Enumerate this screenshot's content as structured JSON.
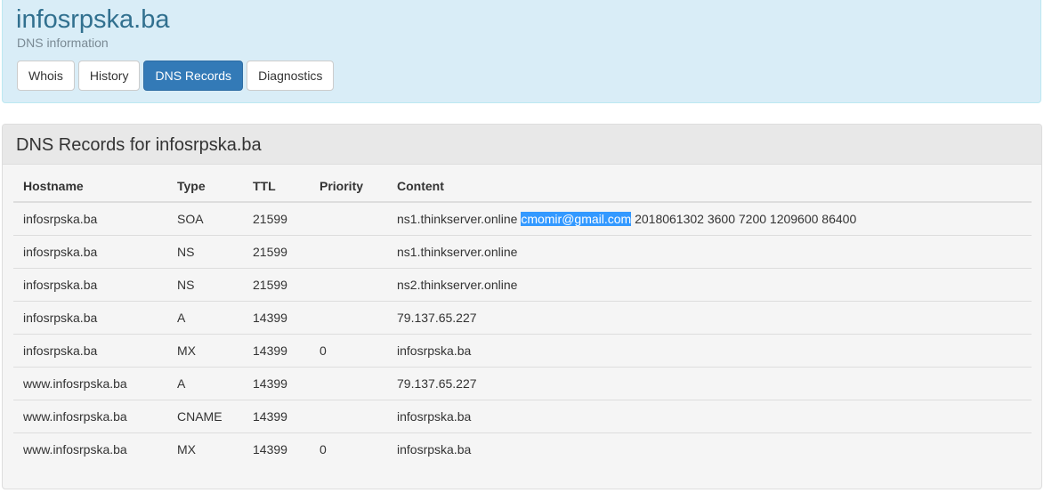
{
  "site": {
    "title": "infosrpska.ba",
    "subtitle": "DNS information"
  },
  "tabs": [
    {
      "label": "Whois",
      "active": false
    },
    {
      "label": "History",
      "active": false
    },
    {
      "label": "DNS Records",
      "active": true
    },
    {
      "label": "Diagnostics",
      "active": false
    }
  ],
  "panel": {
    "heading": "DNS Records for infosrpska.ba"
  },
  "table": {
    "columns": [
      "Hostname",
      "Type",
      "TTL",
      "Priority",
      "Content"
    ],
    "rows": [
      {
        "hostname": "infosrpska.ba",
        "type": "SOA",
        "ttl": "21599",
        "priority": "",
        "content_pre": "ns1.thinkserver.online ",
        "content_highlight": "cmomir@gmail.com",
        "content_post": " 2018061302 3600 7200 1209600 86400"
      },
      {
        "hostname": "infosrpska.ba",
        "type": "NS",
        "ttl": "21599",
        "priority": "",
        "content_pre": "ns1.thinkserver.online",
        "content_highlight": "",
        "content_post": ""
      },
      {
        "hostname": "infosrpska.ba",
        "type": "NS",
        "ttl": "21599",
        "priority": "",
        "content_pre": "ns2.thinkserver.online",
        "content_highlight": "",
        "content_post": ""
      },
      {
        "hostname": "infosrpska.ba",
        "type": "A",
        "ttl": "14399",
        "priority": "",
        "content_pre": "79.137.65.227",
        "content_highlight": "",
        "content_post": ""
      },
      {
        "hostname": "infosrpska.ba",
        "type": "MX",
        "ttl": "14399",
        "priority": "0",
        "content_pre": "infosrpska.ba",
        "content_highlight": "",
        "content_post": ""
      },
      {
        "hostname": "www.infosrpska.ba",
        "type": "A",
        "ttl": "14399",
        "priority": "",
        "content_pre": "79.137.65.227",
        "content_highlight": "",
        "content_post": ""
      },
      {
        "hostname": "www.infosrpska.ba",
        "type": "CNAME",
        "ttl": "14399",
        "priority": "",
        "content_pre": "infosrpska.ba",
        "content_highlight": "",
        "content_post": ""
      },
      {
        "hostname": "www.infosrpska.ba",
        "type": "MX",
        "ttl": "14399",
        "priority": "0",
        "content_pre": "infosrpska.ba",
        "content_highlight": "",
        "content_post": ""
      }
    ]
  },
  "colors": {
    "header_bg": "#d9edf7",
    "title": "#31708f",
    "active_tab": "#337ab7",
    "selection": "#3399ff"
  }
}
